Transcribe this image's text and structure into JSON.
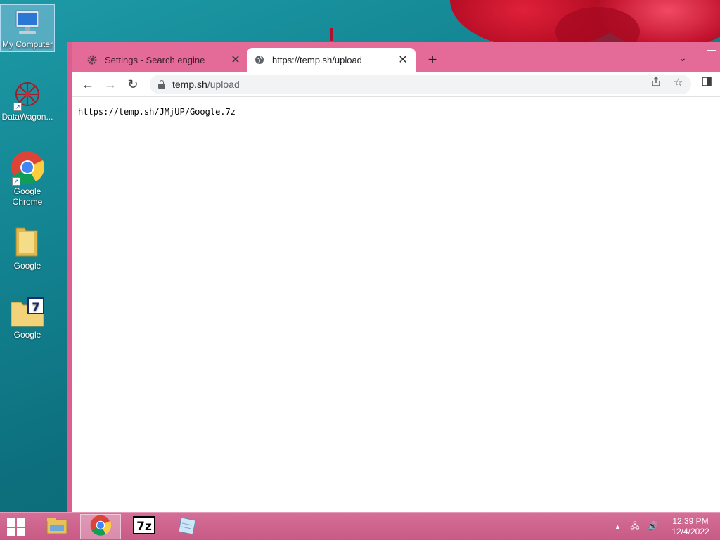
{
  "desktop": {
    "icons": [
      {
        "label": "My Computer"
      },
      {
        "label": "DataWagon..."
      },
      {
        "label": "Google Chrome"
      },
      {
        "label": "Google"
      },
      {
        "label": "Google"
      }
    ]
  },
  "browser": {
    "tabs": [
      {
        "title": "Settings - Search engine",
        "icon": "gear-icon"
      },
      {
        "title": "https://temp.sh/upload",
        "icon": "globe-icon"
      }
    ],
    "new_tab": "+",
    "address": {
      "host": "temp.sh",
      "path": "/upload"
    },
    "page_text": "https://temp.sh/JMjUP/Google.7z"
  },
  "taskbar": {
    "clock_time": "12:39 PM",
    "clock_date": "12/4/2022"
  },
  "colors": {
    "window_frame": "#e05a8e",
    "desktop_bg": "#12818f",
    "taskbar": "#c85a86"
  }
}
